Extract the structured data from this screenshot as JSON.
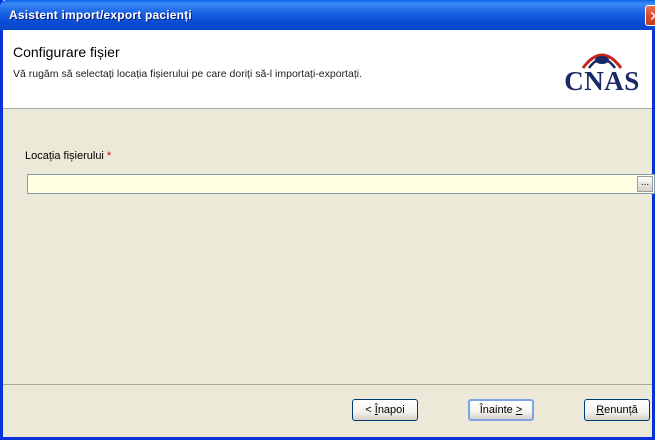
{
  "window": {
    "title": "Asistent import/export pacienți"
  },
  "header": {
    "title": "Configurare fișier",
    "subtitle": "Vă rugăm să selectați locația fișierului pe care doriți să-l importați-exportați.",
    "logo_text": "CNAS"
  },
  "form": {
    "file_label": "Locația fișierului",
    "required_marker": "*",
    "file_value": "",
    "browse_label": "..."
  },
  "buttons": {
    "back_mnemonic": "Î",
    "back_rest": "napoi",
    "back_prefix": "< ",
    "next_text": "Înainte ",
    "next_mnemonic": ">",
    "cancel_mnemonic": "R",
    "cancel_rest": "enunță"
  },
  "colors": {
    "titlebar": "#0a4fd5",
    "input_bg": "#ffffe1",
    "logo": "#1a2a66",
    "logo_accent": "#c4261e",
    "required": "#d00000"
  }
}
